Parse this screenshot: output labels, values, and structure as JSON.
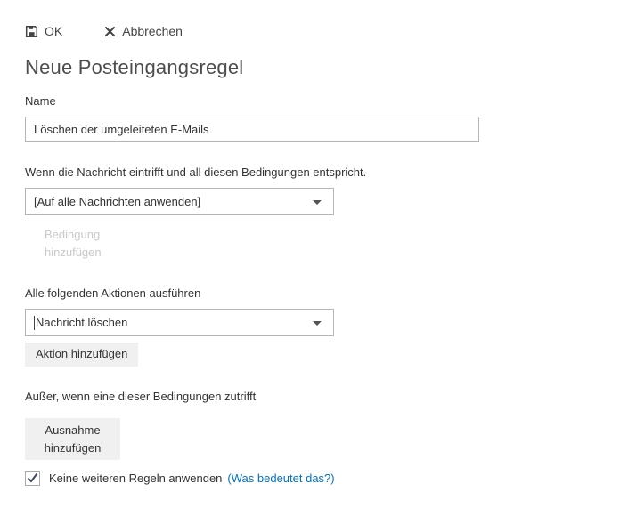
{
  "toolbar": {
    "ok_label": "OK",
    "cancel_label": "Abbrechen"
  },
  "page": {
    "title": "Neue Posteingangsregel"
  },
  "form": {
    "name": {
      "label": "Name",
      "value": "Löschen der umgeleiteten E-Mails"
    },
    "conditions": {
      "label": "Wenn die Nachricht eintrifft und all diesen Bedingungen entspricht.",
      "selected_option": "[Auf alle Nachrichten anwenden]",
      "add_button_label": "Bedingung hinzufügen",
      "add_button_enabled": false
    },
    "actions": {
      "label": "Alle folgenden Aktionen ausführen",
      "selected_option": "Nachricht löschen",
      "add_button_label": "Aktion hinzufügen"
    },
    "exceptions": {
      "label": "Außer, wenn eine dieser Bedingungen zutrifft",
      "add_button_label": "Ausnahme hinzufügen"
    },
    "stop_rule": {
      "checked": true,
      "label": "Keine weiteren Regeln anwenden",
      "help_link_label": "(Was bedeutet das?)"
    }
  },
  "icons": {
    "save": "floppy-disk",
    "cancel": "✕",
    "dropdown": "▼",
    "checkbox_check": "✓"
  },
  "colors": {
    "text": "#333333",
    "title": "#4d4d4d",
    "link": "#0072c6",
    "disabled_text": "#c9c9c9",
    "button_background": "#f0f0f0",
    "input_border": "#b5b5b5",
    "checkmark": "#3d4b5c"
  }
}
